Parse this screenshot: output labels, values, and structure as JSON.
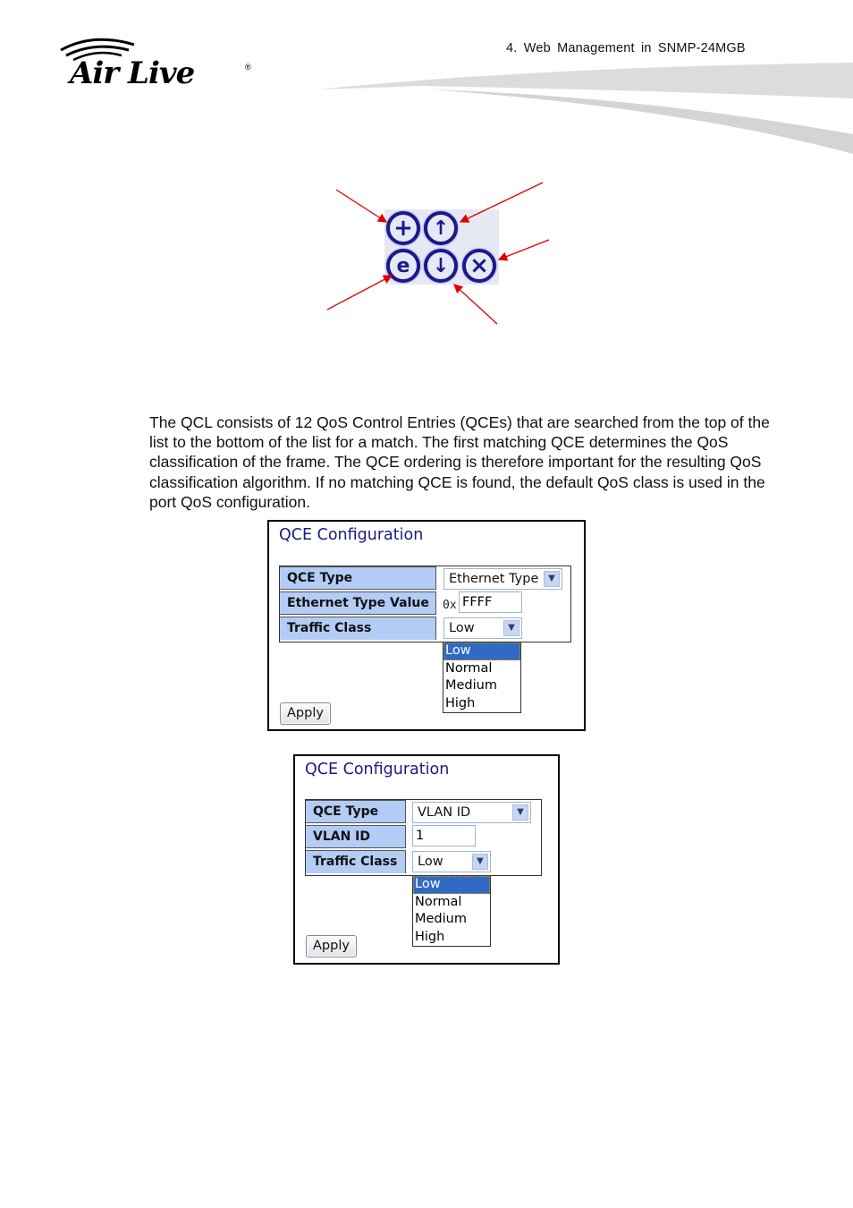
{
  "header": {
    "logo_text": "Air Live",
    "logo_mark": "®",
    "chapter_title": "4.   Web Management in SNMP-24MGB"
  },
  "icon_figure": {
    "icons": [
      {
        "name": "add-icon",
        "glyph": "+"
      },
      {
        "name": "move-up-icon",
        "glyph": "↑"
      },
      {
        "name": "edit-icon",
        "glyph": "e"
      },
      {
        "name": "move-down-icon",
        "glyph": "↓"
      },
      {
        "name": "delete-icon",
        "glyph": "×"
      }
    ],
    "arrow_color": "#e00000",
    "icon_color": "#1a1a8c"
  },
  "paragraph": "The QCL consists of 12 QoS Control Entries (QCEs) that are searched from the top of the list to the bottom of the list for a match. The first matching QCE determines the QoS classification of the frame. The QCE ordering is therefore important for the resulting QoS classification algorithm. If no matching QCE is found, the default QoS class is used in the port QoS configuration.",
  "panel1": {
    "title": "QCE Configuration",
    "rows": [
      {
        "label": "QCE Type",
        "value": "Ethernet Type"
      },
      {
        "label": "Ethernet Type Value",
        "prefix": "0x",
        "value": "FFFF"
      },
      {
        "label": "Traffic Class",
        "value": "Low"
      }
    ],
    "options": [
      "Low",
      "Normal",
      "Medium",
      "High"
    ],
    "selected_option": "Low",
    "apply_label": "Apply"
  },
  "panel2": {
    "title": "QCE Configuration",
    "rows": [
      {
        "label": "QCE Type",
        "value": "VLAN ID"
      },
      {
        "label": "VLAN ID",
        "value": "1"
      },
      {
        "label": "Traffic Class",
        "value": "Low"
      }
    ],
    "options": [
      "Low",
      "Normal",
      "Medium",
      "High"
    ],
    "selected_option": "Low",
    "apply_label": "Apply"
  },
  "colors": {
    "label_bg": "#b3ccf5",
    "title_color": "#1a1a80",
    "selected_bg": "#3169c6"
  }
}
